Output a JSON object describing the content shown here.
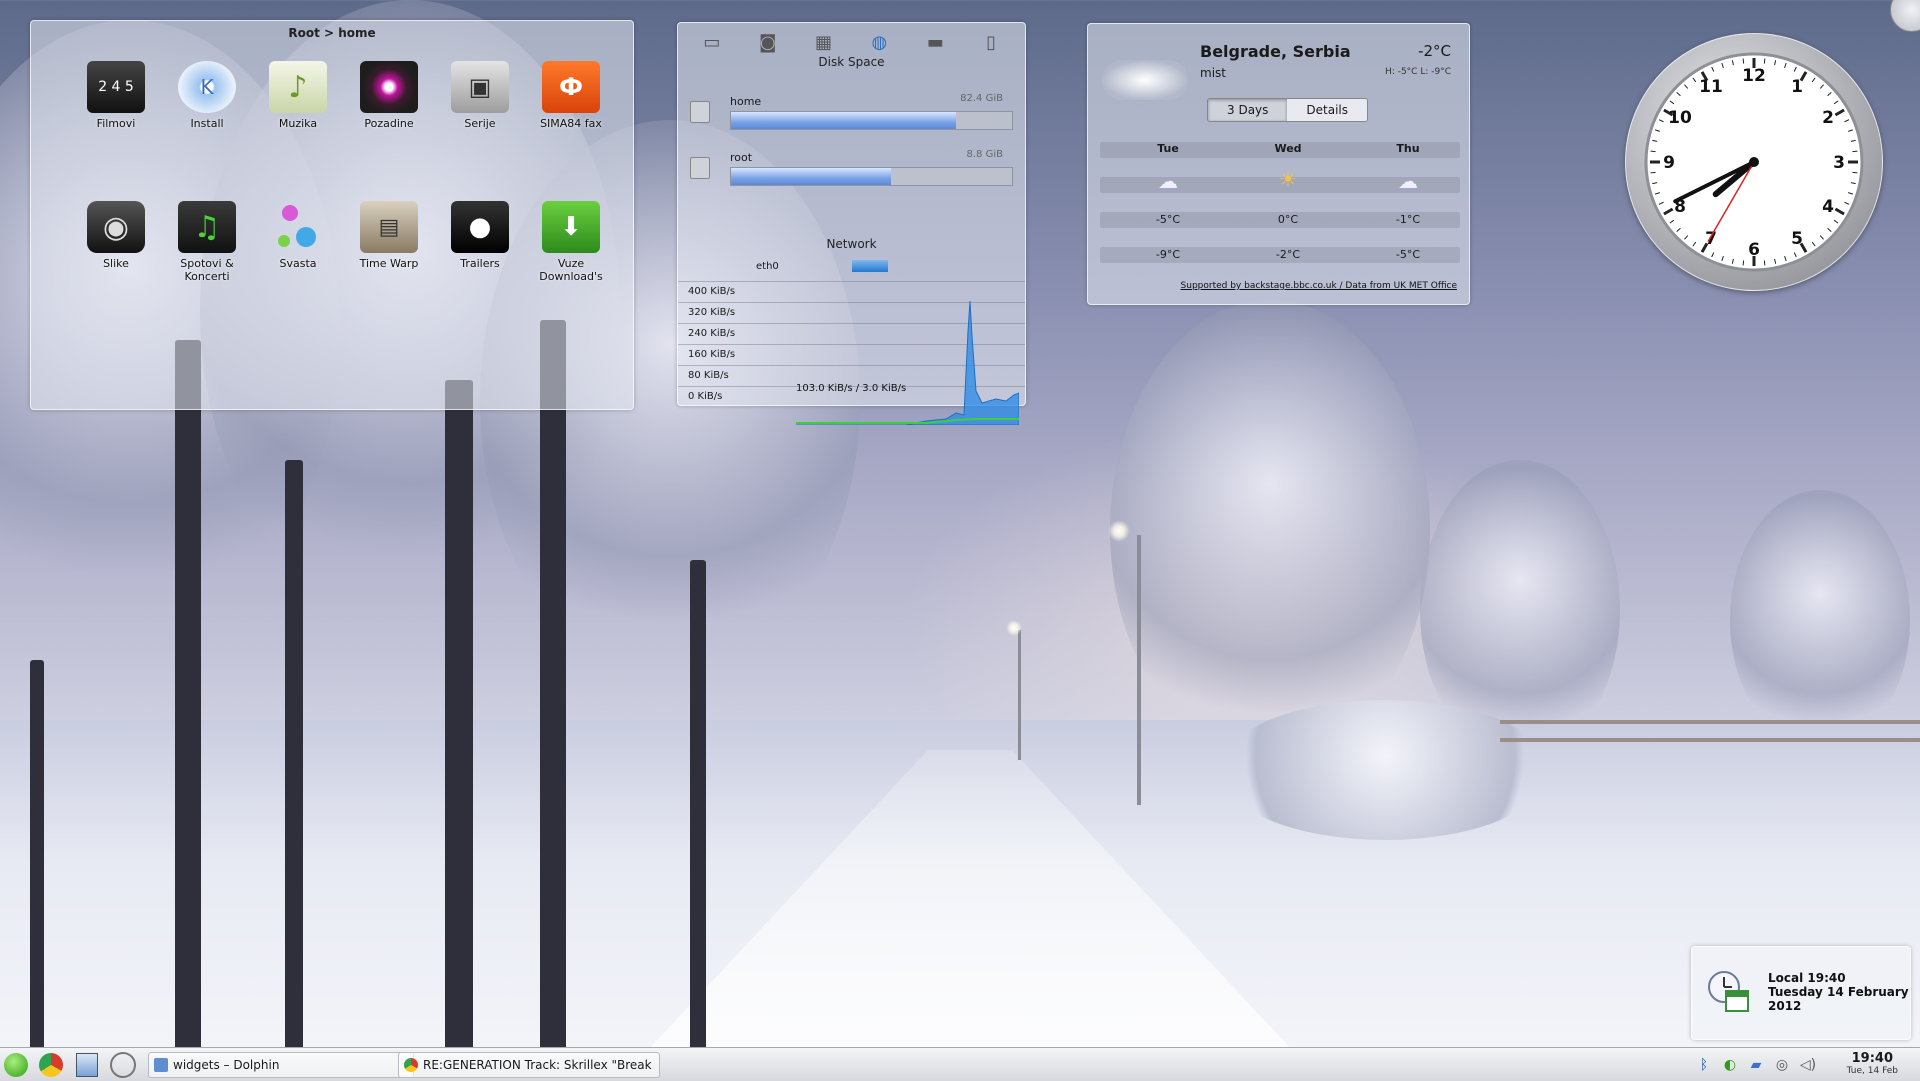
{
  "folder_view": {
    "title": "Root > home",
    "icons": [
      {
        "name": "Filmovi",
        "icon": "clapperboard-icon"
      },
      {
        "name": "Install",
        "icon": "install-disc-icon"
      },
      {
        "name": "Muzika",
        "icon": "music-folder-icon"
      },
      {
        "name": "Pozadine",
        "icon": "eye-icon"
      },
      {
        "name": "Serije",
        "icon": "camcorder-icon"
      },
      {
        "name": "SIMA84 fax",
        "icon": "tp-logo-icon"
      },
      {
        "name": "Slike",
        "icon": "camera-icon"
      },
      {
        "name": "Spotovi & Koncerti",
        "icon": "music-clapper-icon"
      },
      {
        "name": "Svasta",
        "icon": "bubbles-icon"
      },
      {
        "name": "Time Warp",
        "icon": "film-strip-icon"
      },
      {
        "name": "Trailers",
        "icon": "apple-icon"
      },
      {
        "name": "Vuze Download's",
        "icon": "download-folder-icon"
      }
    ]
  },
  "system_monitor": {
    "tab_icons": [
      "drive-icon",
      "disk-icon",
      "chip-icon",
      "globe-icon",
      "display-icon",
      "battery-icon"
    ],
    "disk_title": "Disk Space",
    "disks": [
      {
        "name": "home",
        "size": "82.4 GiB",
        "used_fraction": 0.8
      },
      {
        "name": "root",
        "size": "8.8 GiB",
        "used_fraction": 0.57
      }
    ],
    "network_title": "Network",
    "interface": "eth0",
    "scale_labels": [
      "400 KiB/s",
      "320 KiB/s",
      "240 KiB/s",
      "160 KiB/s",
      "80 KiB/s",
      "0 KiB/s"
    ],
    "current_value": "103.0 KiB/s / 3.0 KiB/s"
  },
  "weather": {
    "city": "Belgrade, Serbia",
    "condition": "mist",
    "temp": "-2°C",
    "hilo": "H: -5°C L: -9°C",
    "tabs": [
      "3 Days",
      "Details"
    ],
    "days": [
      {
        "day": "Tue",
        "icon": "snow-cloud-icon",
        "high": "-5°C",
        "low": "-9°C"
      },
      {
        "day": "Wed",
        "icon": "sun-cloud-icon",
        "high": "0°C",
        "low": "-2°C"
      },
      {
        "day": "Thu",
        "icon": "snow-cloud-icon",
        "high": "-1°C",
        "low": "-5°C"
      }
    ],
    "footer": "Supported by backstage.bbc.co.uk / Data from UK MET Office"
  },
  "analog_clock": {
    "hour": 19,
    "minute": 40,
    "second": 35
  },
  "calendar_popup": {
    "line1": "Local 19:40",
    "line2": "Tuesday 14 February",
    "line3": "2012"
  },
  "taskbar": {
    "launchers": [
      "kickoff-icon",
      "chrome-icon",
      "file-manager-icon",
      "network-icon"
    ],
    "tasks": [
      {
        "label": "widgets – Dolphin",
        "icon": "dolphin-icon"
      },
      {
        "label": "RE:GENERATION Track: Skrillex \"Break",
        "icon": "chrome-icon"
      }
    ],
    "tray": [
      "bluetooth-icon",
      "network-tray-icon",
      "updates-icon",
      "klipper-icon",
      "volume-icon"
    ],
    "clock_time": "19:40",
    "clock_date": "Tue, 14 Feb"
  }
}
